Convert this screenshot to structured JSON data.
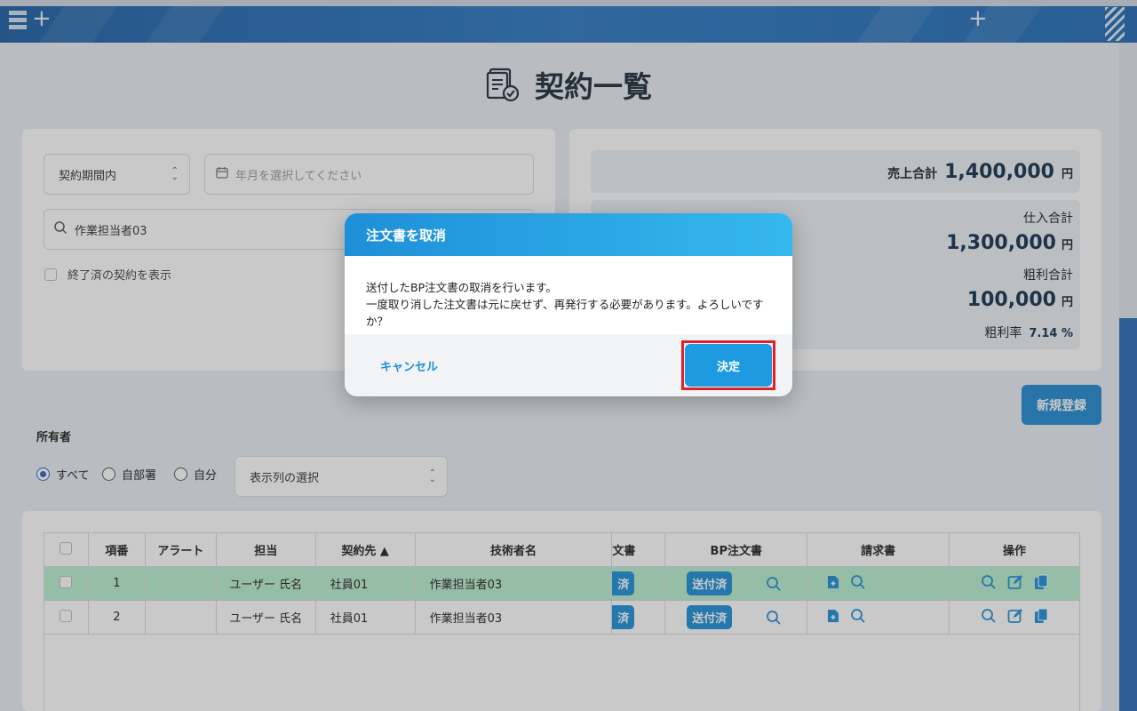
{
  "page": {
    "title": "契約一覧"
  },
  "filters": {
    "period_select": "契約期間内",
    "date_placeholder": "年月を選択してください",
    "search_value": "作業担当者03",
    "show_finished_label": "終了済の契約を表示"
  },
  "summary": {
    "sales_label": "売上合計",
    "sales_value": "1,400,000",
    "purchase_label": "仕入合計",
    "purchase_value": "1,300,000",
    "gross_label": "粗利合計",
    "gross_value": "100,000",
    "rate_label": "粗利率",
    "rate_value": "7.14 %",
    "yen": "円"
  },
  "new_button": "新規登録",
  "owner": {
    "label": "所有者",
    "options": [
      "すべて",
      "自部署",
      "自分"
    ],
    "selected": "すべて",
    "columns_select": "表示列の選択"
  },
  "table": {
    "headers": [
      "項番",
      "アラート",
      "担当",
      "契約先 ▲",
      "技術者名",
      "文書",
      "BP注文書",
      "請求書",
      "操作"
    ],
    "rows": [
      {
        "no": "1",
        "alert": "",
        "person": "ユーザー 氏名",
        "client": "社員01",
        "engineer": "作業担当者03",
        "doc_badge": "済",
        "bp_badge": "送付済",
        "highlight": true
      },
      {
        "no": "2",
        "alert": "",
        "person": "ユーザー 氏名",
        "client": "社員01",
        "engineer": "作業担当者03",
        "doc_badge": "済",
        "bp_badge": "送付済",
        "highlight": false
      }
    ]
  },
  "modal": {
    "title": "注文書を取消",
    "line1": "送付したBP注文書の取消を行います。",
    "line2": "一度取り消した注文書は元に戻せず、再発行する必要があります。よろしいですか？",
    "cancel": "キャンセル",
    "confirm": "決定"
  },
  "colors": {
    "accent": "#1d9ae0",
    "highlight_row": "#b9efcd",
    "header_bar": "#1c5fa6",
    "outline": "#e0202a"
  }
}
